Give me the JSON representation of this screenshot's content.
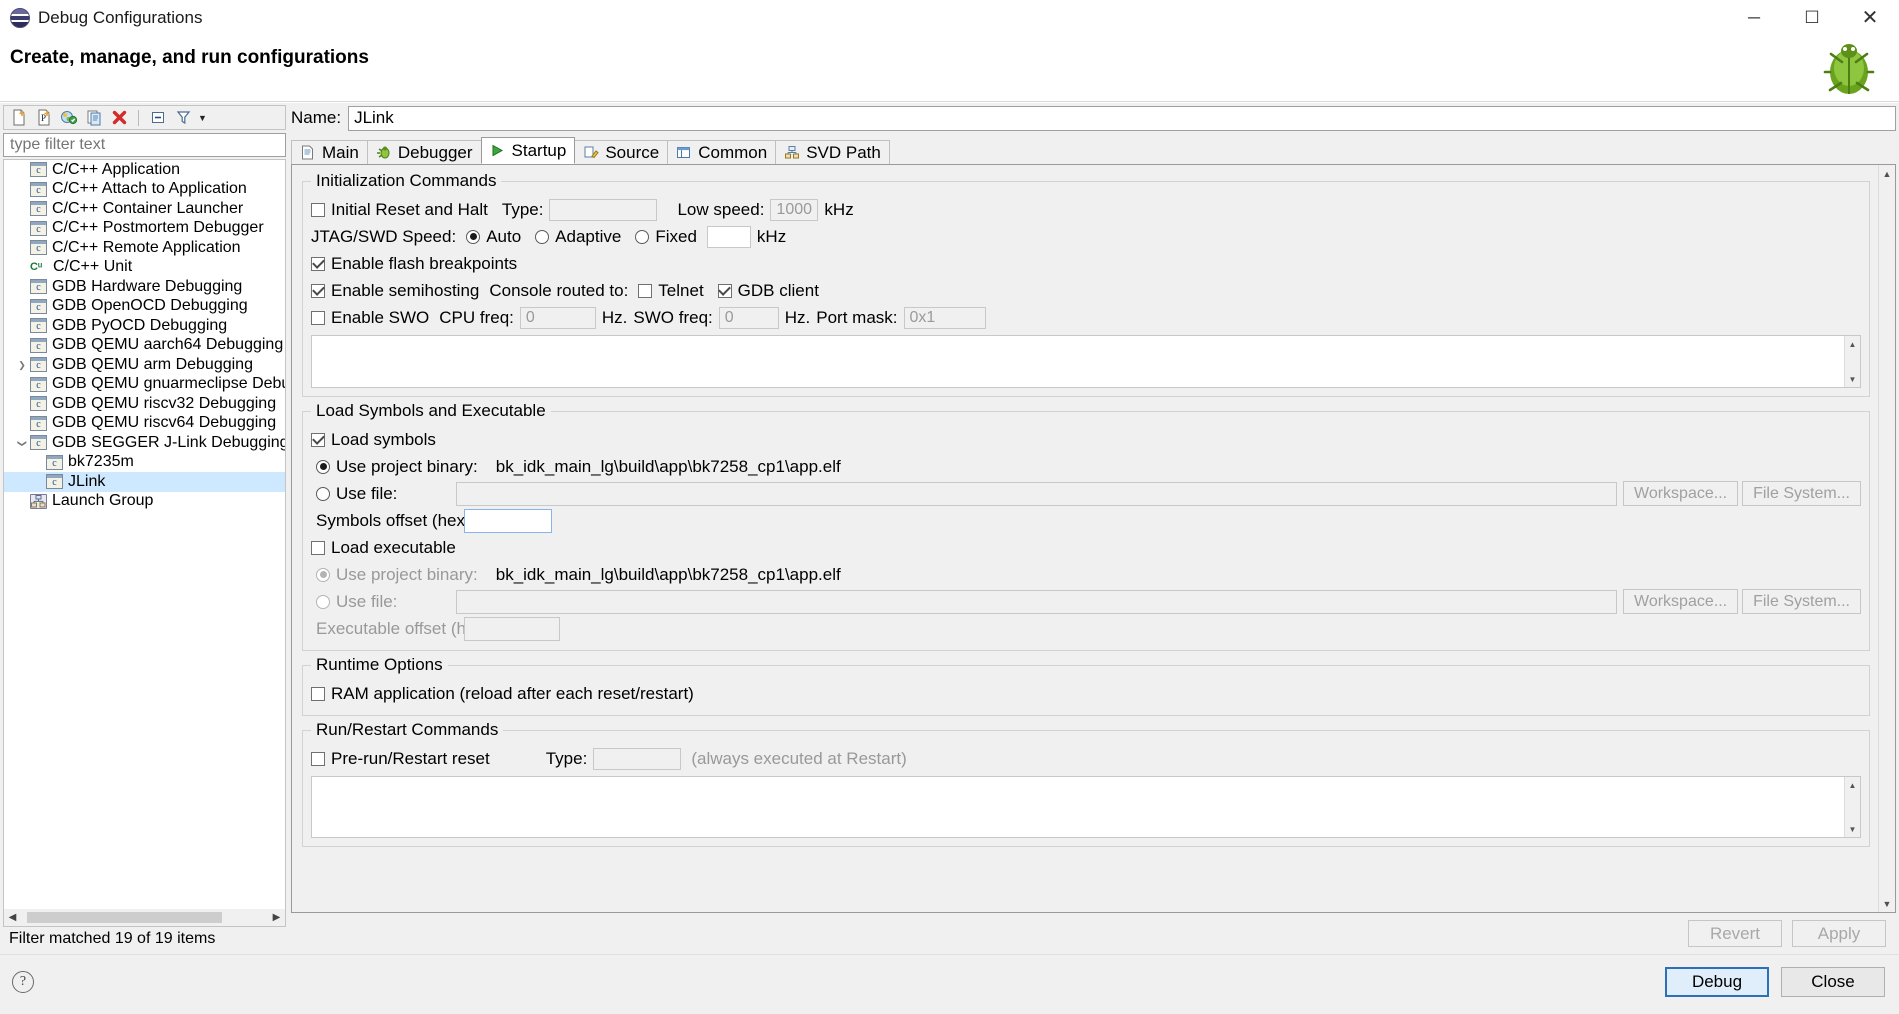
{
  "window": {
    "title": "Debug Configurations",
    "icon": "eclipse-icon",
    "minimize": "─",
    "maximize": "☐",
    "close": "✕"
  },
  "header": {
    "title": "Create, manage, and run configurations",
    "decor_icon": "bug-icon"
  },
  "tree_toolbar": {
    "buttons": [
      {
        "name": "new-launch-configuration",
        "icon": "new-config-icon"
      },
      {
        "name": "new-prototype",
        "icon": "new-prototype-icon"
      },
      {
        "name": "export-configuration",
        "icon": "export-icon"
      },
      {
        "name": "duplicate-configuration",
        "icon": "duplicate-icon"
      },
      {
        "name": "delete-configuration",
        "icon": "delete-icon"
      },
      {
        "name": "collapse-all",
        "icon": "collapse-all-icon"
      },
      {
        "name": "filter-configurations",
        "icon": "filter-icon"
      },
      {
        "name": "view-menu",
        "icon": "chevron-down-icon"
      }
    ]
  },
  "filter": {
    "placeholder": "type filter text",
    "value": ""
  },
  "tree": {
    "items": [
      {
        "label": "C/C++ Application",
        "icon": "config-icon",
        "indent": 1,
        "twisty": "",
        "selected": false
      },
      {
        "label": "C/C++ Attach to Application",
        "icon": "config-icon",
        "indent": 1,
        "twisty": "",
        "selected": false
      },
      {
        "label": "C/C++ Container Launcher",
        "icon": "config-icon",
        "indent": 1,
        "twisty": "",
        "selected": false
      },
      {
        "label": "C/C++ Postmortem Debugger",
        "icon": "config-icon",
        "indent": 1,
        "twisty": "",
        "selected": false
      },
      {
        "label": "C/C++ Remote Application",
        "icon": "config-icon",
        "indent": 1,
        "twisty": "",
        "selected": false
      },
      {
        "label": "C/C++ Unit",
        "icon": "cunit-icon",
        "indent": 1,
        "twisty": "",
        "selected": false
      },
      {
        "label": "GDB Hardware Debugging",
        "icon": "config-icon",
        "indent": 1,
        "twisty": "",
        "selected": false
      },
      {
        "label": "GDB OpenOCD Debugging",
        "icon": "config-icon",
        "indent": 1,
        "twisty": "",
        "selected": false
      },
      {
        "label": "GDB PyOCD Debugging",
        "icon": "config-icon",
        "indent": 1,
        "twisty": "",
        "selected": false
      },
      {
        "label": "GDB QEMU aarch64 Debugging",
        "icon": "config-icon",
        "indent": 1,
        "twisty": "",
        "selected": false
      },
      {
        "label": "GDB QEMU arm Debugging",
        "icon": "config-icon",
        "indent": 1,
        "twisty": "right",
        "selected": false
      },
      {
        "label": "GDB QEMU gnuarmeclipse Debugging (",
        "icon": "config-icon",
        "indent": 1,
        "twisty": "",
        "selected": false
      },
      {
        "label": "GDB QEMU riscv32 Debugging",
        "icon": "config-icon",
        "indent": 1,
        "twisty": "",
        "selected": false
      },
      {
        "label": "GDB QEMU riscv64 Debugging",
        "icon": "config-icon",
        "indent": 1,
        "twisty": "",
        "selected": false
      },
      {
        "label": "GDB SEGGER J-Link Debugging",
        "icon": "config-icon",
        "indent": 1,
        "twisty": "down",
        "selected": false
      },
      {
        "label": "bk7235m",
        "icon": "config-icon",
        "indent": 2,
        "twisty": "",
        "selected": false
      },
      {
        "label": "JLink",
        "icon": "config-icon",
        "indent": 2,
        "twisty": "",
        "selected": true
      },
      {
        "label": "Launch Group",
        "icon": "group-icon",
        "indent": 1,
        "twisty": "",
        "selected": false
      }
    ],
    "status": "Filter matched 19 of 19 items"
  },
  "config": {
    "name_label": "Name:",
    "name_value": "JLink"
  },
  "tabs": [
    {
      "label": "Main",
      "icon": "document-icon",
      "active": false
    },
    {
      "label": "Debugger",
      "icon": "debugger-icon",
      "active": false
    },
    {
      "label": "Startup",
      "icon": "run-icon",
      "active": true
    },
    {
      "label": "Source",
      "icon": "source-icon",
      "active": false
    },
    {
      "label": "Common",
      "icon": "common-icon",
      "active": false
    },
    {
      "label": "SVD Path",
      "icon": "svd-icon",
      "active": false
    }
  ],
  "startup": {
    "init_group": {
      "legend": "Initialization Commands",
      "initial_reset_label": "Initial Reset and Halt",
      "initial_reset_checked": false,
      "type_label": "Type:",
      "type_value": "",
      "low_speed_label": "Low speed:",
      "low_speed_value": "1000",
      "low_speed_unit": "kHz",
      "jtag_label": "JTAG/SWD Speed:",
      "jtag_options": [
        "Auto",
        "Adaptive",
        "Fixed"
      ],
      "jtag_selected": "Auto",
      "fixed_value": "",
      "fixed_unit": "kHz",
      "flash_bp_label": "Enable flash breakpoints",
      "flash_bp_checked": true,
      "semihosting_label": "Enable semihosting",
      "semihosting_checked": true,
      "console_label": "Console routed to:",
      "telnet_label": "Telnet",
      "telnet_checked": false,
      "gdb_client_label": "GDB client",
      "gdb_client_checked": true,
      "swo_label": "Enable SWO",
      "swo_checked": false,
      "cpu_freq_label": "CPU freq:",
      "cpu_freq_value": "0",
      "cpu_freq_unit": "Hz.",
      "swo_freq_label": "SWO freq:",
      "swo_freq_value": "0",
      "swo_freq_unit": "Hz.",
      "port_mask_label": "Port mask:",
      "port_mask_value": "0x1",
      "commands_text": ""
    },
    "load_group": {
      "legend": "Load Symbols and Executable",
      "load_symbols_label": "Load symbols",
      "load_symbols_checked": true,
      "sym_use_project_label": "Use project binary:",
      "sym_use_project_selected": true,
      "sym_project_path": "bk_idk_main_lg\\build\\app\\bk7258_cp1\\app.elf",
      "sym_use_file_label": "Use file:",
      "sym_use_file_selected": false,
      "sym_file_value": "",
      "sym_workspace_btn": "Workspace...",
      "sym_filesystem_btn": "File System...",
      "symbols_offset_label": "Symbols offset (hex):",
      "symbols_offset_value": "",
      "load_exec_label": "Load executable",
      "load_exec_checked": false,
      "exec_use_project_label": "Use project binary:",
      "exec_use_project_selected": true,
      "exec_project_path": "bk_idk_main_lg\\build\\app\\bk7258_cp1\\app.elf",
      "exec_use_file_label": "Use file:",
      "exec_use_file_selected": false,
      "exec_file_value": "",
      "exec_workspace_btn": "Workspace...",
      "exec_filesystem_btn": "File System...",
      "exec_offset_label": "Executable offset (hex):",
      "exec_offset_value": ""
    },
    "runtime_group": {
      "legend": "Runtime Options",
      "ram_app_label": "RAM application (reload after each reset/restart)",
      "ram_app_checked": false
    },
    "runrestart_group": {
      "legend": "Run/Restart Commands",
      "prerun_label": "Pre-run/Restart reset",
      "prerun_checked": false,
      "type_label": "Type:",
      "type_value": "",
      "note": "(always executed at Restart)",
      "commands_text": ""
    }
  },
  "form_buttons": {
    "revert": "Revert",
    "apply": "Apply"
  },
  "dialog_buttons": {
    "help_icon": "help-icon",
    "debug": "Debug",
    "close": "Close"
  }
}
